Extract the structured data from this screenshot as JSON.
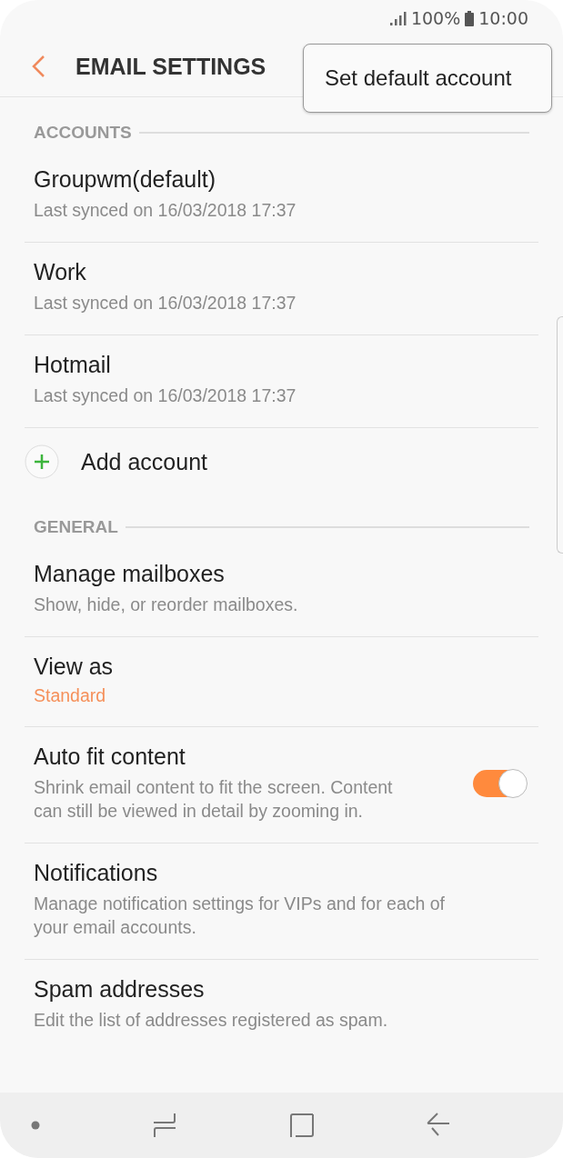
{
  "status_bar": {
    "battery": "100%",
    "time": "10:00"
  },
  "header": {
    "title": "EMAIL SETTINGS"
  },
  "menu": {
    "items": [
      "Set default account"
    ]
  },
  "sections": [
    {
      "title": "ACCOUNTS",
      "items": [
        {
          "kind": "account",
          "title": "Groupwm(default)",
          "subtitle": "Last synced on 16/03/2018  17:37"
        },
        {
          "kind": "account",
          "title": "Work",
          "subtitle": "Last synced on 16/03/2018  17:37"
        },
        {
          "kind": "account",
          "title": "Hotmail",
          "subtitle": "Last synced on 16/03/2018  17:37"
        },
        {
          "kind": "add",
          "title": "Add account"
        }
      ]
    },
    {
      "title": "GENERAL",
      "items": [
        {
          "kind": "setting",
          "title": "Manage mailboxes",
          "subtitle": "Show, hide, or reorder mailboxes."
        },
        {
          "kind": "value",
          "title": "View as",
          "value": "Standard"
        },
        {
          "kind": "toggle",
          "title": "Auto fit content",
          "subtitle": "Shrink email content to fit the screen. Content can still be viewed in detail by zooming in.",
          "on": true
        },
        {
          "kind": "setting",
          "title": "Notifications",
          "subtitle": "Manage notification settings for VIPs and for each of your email accounts."
        },
        {
          "kind": "setting",
          "title": "Spam addresses",
          "subtitle": "Edit the list of addresses registered as spam."
        }
      ]
    }
  ]
}
